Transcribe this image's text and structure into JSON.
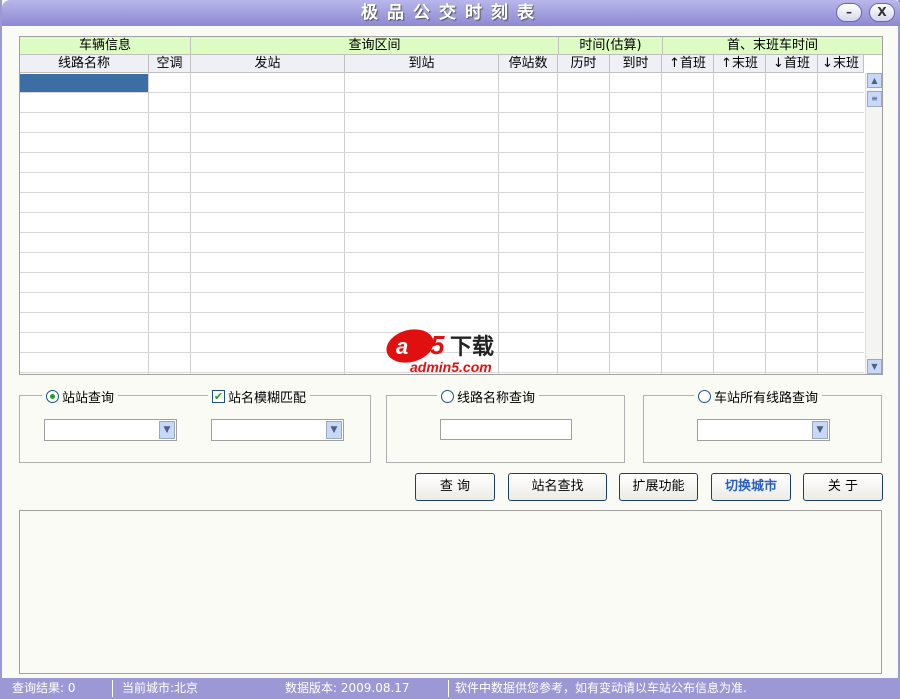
{
  "title": "极品公交时刻表",
  "window_buttons": {
    "minimize": "–",
    "close": "X"
  },
  "table": {
    "group_headers": [
      "车辆信息",
      "查询区间",
      "时间(估算)",
      "首、末班车时间"
    ],
    "columns": [
      "线路名称",
      "空调",
      "发站",
      "到站",
      "停站数",
      "历时",
      "到时",
      "↑首班",
      "↑末班",
      "↓首班",
      "↓末班"
    ],
    "rows": []
  },
  "query": {
    "station_query": "站站查询",
    "fuzzy_match": "站名模糊匹配",
    "line_name_query": "线路名称查询",
    "station_lines_query": "车站所有线路查询"
  },
  "buttons": {
    "query": "查 询",
    "find_station": "站名查找",
    "extend": "扩展功能",
    "switch_city": "切换城市",
    "about": "关 于"
  },
  "status": {
    "result": "查询结果: 0",
    "city": "当前城市:北京",
    "version": "数据版本: 2009.08.17",
    "notice": "软件中数据供您参考，如有变动请以车站公布信息为准."
  },
  "watermark": {
    "logo": "a5下载",
    "site": "admin5.com"
  },
  "colors": {
    "title": "#9c98d6",
    "header_green": "#dcfcc4",
    "selection": "#3c6ea5",
    "switch_city_text": "#2a5fbf"
  }
}
